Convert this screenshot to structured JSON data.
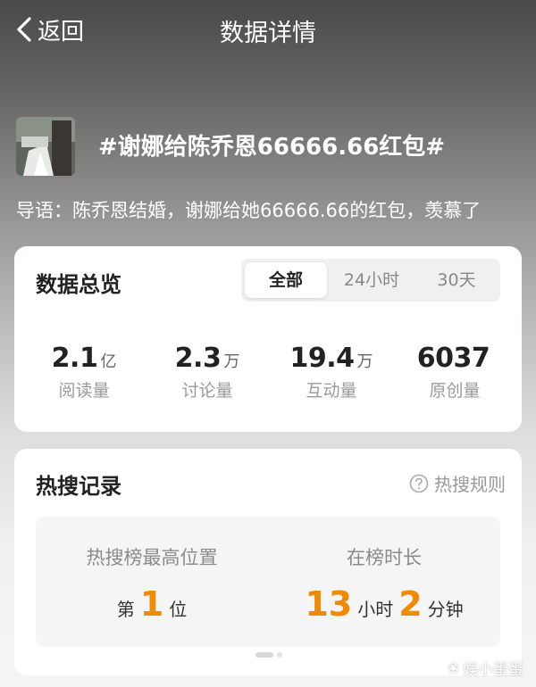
{
  "header": {
    "back_label": "返回",
    "title": "数据详情"
  },
  "topic": {
    "title": "#谢娜给陈乔恩66666.66红包#",
    "intro": "导语：陈乔恩结婚，谢娜给她66666.66的红包，羡慕了"
  },
  "overview": {
    "title": "数据总览",
    "tabs": [
      "全部",
      "24小时",
      "30天"
    ],
    "active_tab": "全部",
    "stats": [
      {
        "value": "2.1",
        "unit": "亿",
        "label": "阅读量"
      },
      {
        "value": "2.3",
        "unit": "万",
        "label": "讨论量"
      },
      {
        "value": "19.4",
        "unit": "万",
        "label": "互动量"
      },
      {
        "value": "6037",
        "unit": "",
        "label": "原创量"
      }
    ]
  },
  "hot_search": {
    "title": "热搜记录",
    "rules_label": "热搜规则",
    "rank_label": "热搜榜最高位置",
    "rank_prefix": "第",
    "rank_value": "1",
    "rank_suffix": "位",
    "duration_label": "在榜时长",
    "hours": "13",
    "hours_unit": "小时",
    "minutes": "2",
    "minutes_unit": "分钟"
  },
  "watermark": "娱小蛋蛋",
  "colors": {
    "accent": "#f08a00",
    "card_bg": "#ffffff"
  },
  "icons": {
    "back": "chevron-left-icon",
    "rules": "question-circle-icon",
    "watermark": "watermark-logo-icon"
  }
}
